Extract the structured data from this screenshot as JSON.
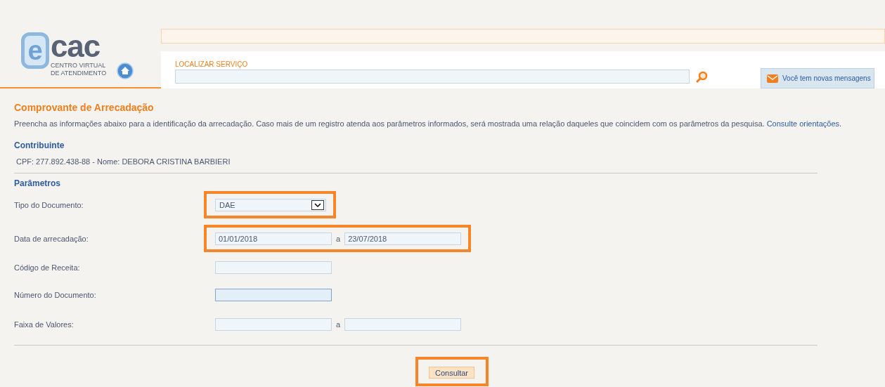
{
  "logo": {
    "letter": "e",
    "wordmark": "cac",
    "tagline_1": "CENTRO VIRTUAL",
    "tagline_2": "DE ATENDIMENTO"
  },
  "search": {
    "label": "LOCALIZAR SERVIÇO"
  },
  "messages_button": "Você tem novas mensagens",
  "page": {
    "title": "Comprovante de Arrecadação",
    "intro": "Preencha as informações abaixo para a identificação da arrecadação. Caso mais de um registro atenda aos parâmetros informados, será mostrada uma relação daqueles que coincidem com os parâmetros da pesquisa.",
    "intro_link": "Consulte orientações."
  },
  "contribuinte": {
    "heading": "Contribuinte",
    "text": "CPF: 277.892.438-88 - Nome: DEBORA CRISTINA BARBIERI"
  },
  "parametros": {
    "heading": "Parâmetros",
    "rows": [
      {
        "kind": "select",
        "label": "Tipo do Documento:",
        "value": "DAE",
        "highlighted": true,
        "focused": false
      },
      {
        "kind": "range",
        "label": "Data de arrecadação:",
        "value": "01/01/2018",
        "separator": "a",
        "value_to": "23/07/2018",
        "highlighted": true,
        "focused": false
      },
      {
        "kind": "text",
        "label": "Código de Receita:",
        "highlighted": false,
        "focused": false
      },
      {
        "kind": "text",
        "label": "Número do Documento:",
        "highlighted": false,
        "focused": true
      },
      {
        "kind": "range",
        "label": "Faixa de Valores:",
        "separator": "a",
        "highlighted": false,
        "focused": false
      }
    ]
  },
  "submit": {
    "label": "Consultar",
    "highlighted": true
  }
}
